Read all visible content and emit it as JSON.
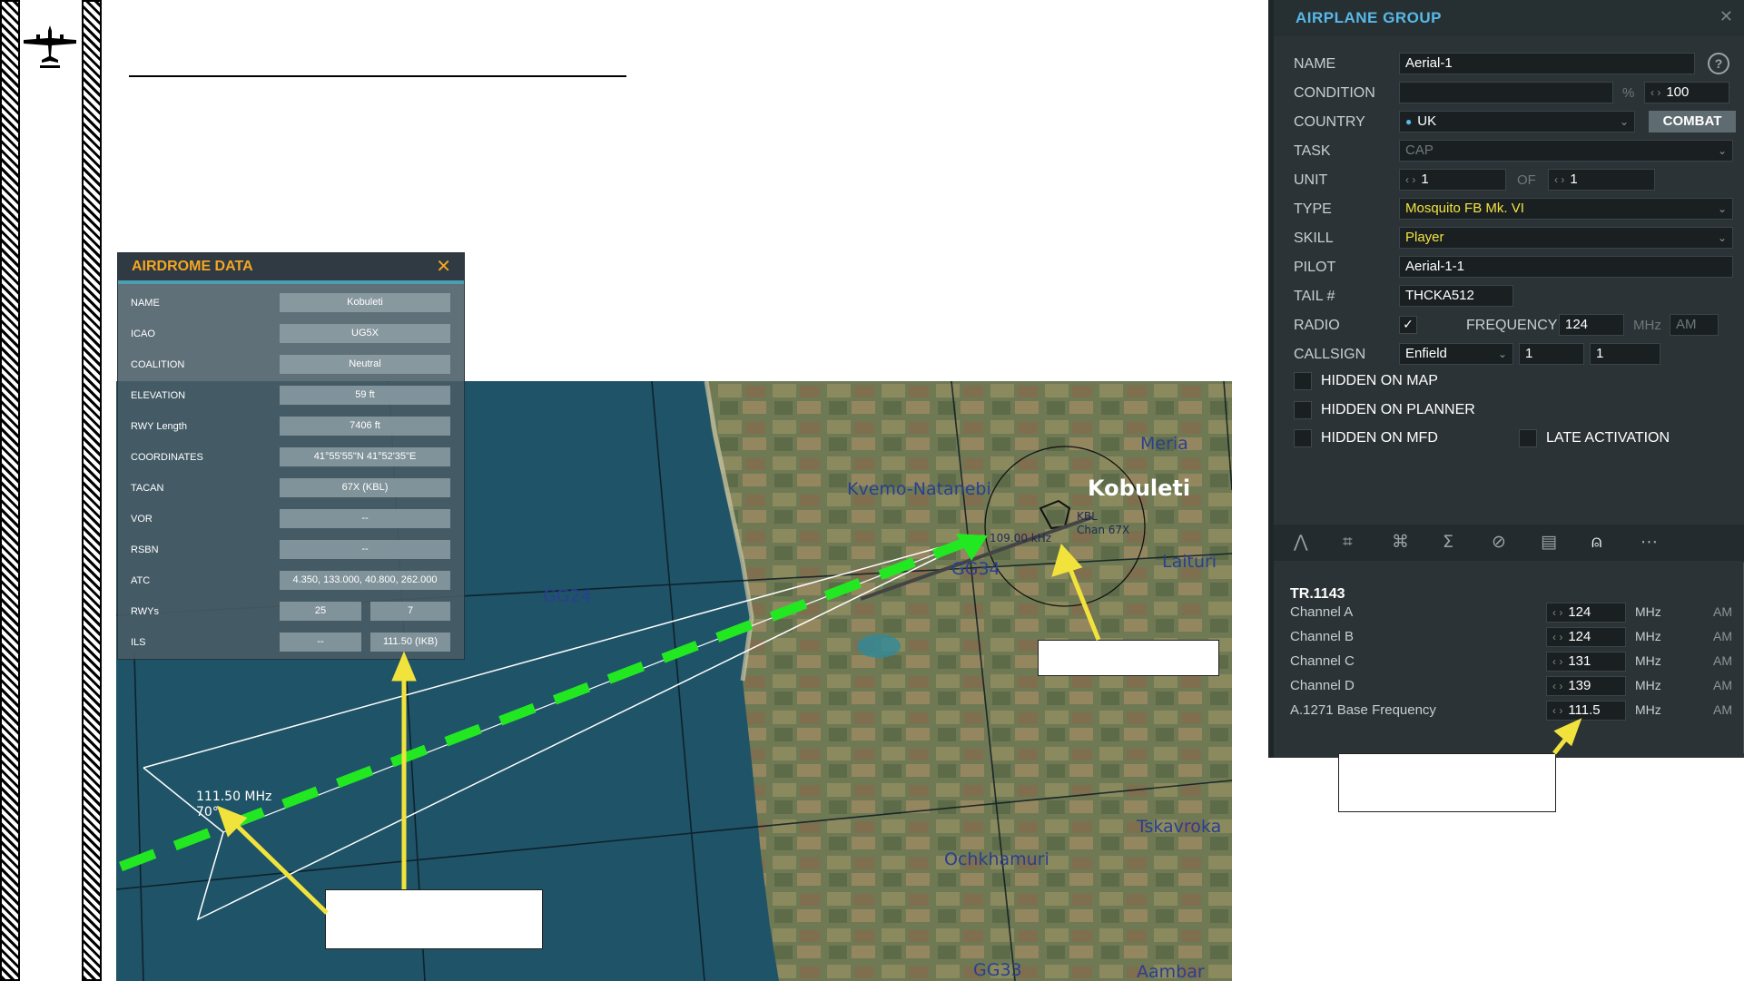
{
  "airdrome": {
    "title": "AIRDROME DATA",
    "close_icon": "close-icon",
    "rows": [
      {
        "label": "NAME",
        "value": "Kobuleti"
      },
      {
        "label": "ICAO",
        "value": "UG5X"
      },
      {
        "label": "COALITION",
        "value": "Neutral"
      },
      {
        "label": "ELEVATION",
        "value": "59 ft"
      },
      {
        "label": "RWY Length",
        "value": "7406 ft"
      },
      {
        "label": "COORDINATES",
        "value": "41°55'55\"N 41°52'35\"E"
      },
      {
        "label": "TACAN",
        "value": "67X (KBL)"
      },
      {
        "label": "VOR",
        "value": "--"
      },
      {
        "label": "RSBN",
        "value": "--"
      },
      {
        "label": "ATC",
        "value": "4.350, 133.000, 40.800, 262.000"
      },
      {
        "label": "RWYs",
        "value_a": "25",
        "value_b": "7"
      },
      {
        "label": "ILS",
        "value_a": "--",
        "value_b": "111.50 (IKB)"
      }
    ]
  },
  "map": {
    "labels": {
      "kobuleti": "Kobuleti",
      "kvemo": "Kvemo-Natanebi",
      "meria": "Meria",
      "laituri": "Laituri",
      "tskavroka": "Tskavroka",
      "ochkhamuri": "Ochkhamuri",
      "aambar": "Aambar",
      "gg24": "GG24",
      "gg34": "GG34",
      "gg33": "GG33",
      "g83": "G83",
      "kbl": "KBL",
      "chan": "Chan 67X",
      "freq_ils": "111.50 MHz",
      "ils_course": "70°",
      "freq_near": "109.00 kHz"
    }
  },
  "group": {
    "title": "AIRPLANE GROUP",
    "name_label": "NAME",
    "name_value": "Aerial-1",
    "help": "?",
    "condition_label": "CONDITION",
    "condition_pct": "%",
    "condition_value": "100",
    "country_label": "COUNTRY",
    "country_value": "UK",
    "combat": "COMBAT",
    "task_label": "TASK",
    "task_value": "CAP",
    "unit_label": "UNIT",
    "unit_value": "1",
    "unit_of": "OF",
    "unit_total": "1",
    "type_label": "TYPE",
    "type_value": "Mosquito FB Mk. VI",
    "skill_label": "SKILL",
    "skill_value": "Player",
    "pilot_label": "PILOT",
    "pilot_value": "Aerial-1-1",
    "tail_label": "TAIL #",
    "tail_value": "THCKA512",
    "radio_label": "RADIO",
    "frequency_label": "FREQUENCY",
    "frequency_value": "124",
    "freq_unit": "MHz",
    "modulation": "AM",
    "callsign_label": "CALLSIGN",
    "callsign_value": "Enfield",
    "callsign_n1": "1",
    "callsign_n2": "1",
    "hidden_map": "HIDDEN ON MAP",
    "hidden_planner": "HIDDEN ON PLANNER",
    "hidden_mfd": "HIDDEN ON MFD",
    "late_activation": "LATE ACTIVATION",
    "radio_name": "TR.1143",
    "channels": [
      {
        "label": "Channel A",
        "value": "124",
        "unit": "MHz",
        "mod": "AM"
      },
      {
        "label": "Channel B",
        "value": "124",
        "unit": "MHz",
        "mod": "AM"
      },
      {
        "label": "Channel C",
        "value": "131",
        "unit": "MHz",
        "mod": "AM"
      },
      {
        "label": "Channel D",
        "value": "139",
        "unit": "MHz",
        "mod": "AM"
      },
      {
        "label": "A.1271 Base Frequency",
        "value": "111.5",
        "unit": "MHz",
        "mod": "AM"
      }
    ],
    "tabs": [
      "route-icon",
      "target-icon",
      "payload-icon",
      "summary-icon",
      "failures-icon",
      "camera-icon",
      "radio-icon",
      "more-icon"
    ]
  },
  "colors": {
    "accent_orange": "#f5a623",
    "accent_blue": "#58b8e8",
    "yellow": "#f2e33c",
    "green_dash": "#22e822"
  }
}
